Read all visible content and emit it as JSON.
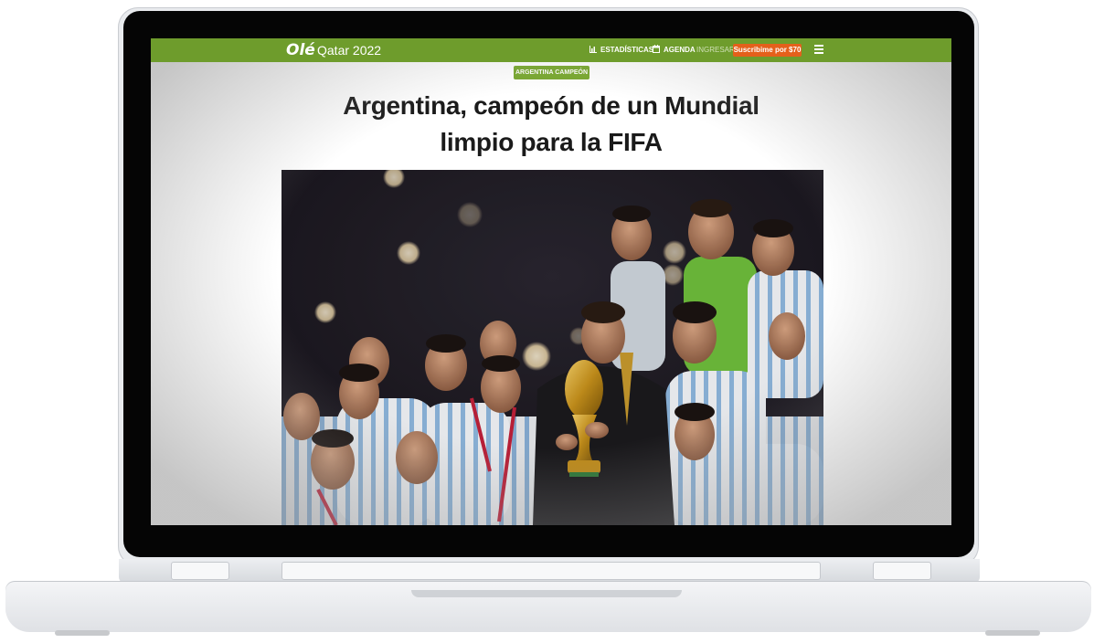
{
  "site": {
    "logo": "Olé",
    "section": "Qatar 2022"
  },
  "nav": {
    "stats_label": "ESTADÍSTICAS",
    "stats_icon": "bar-chart-icon",
    "agenda_label": "AGENDA",
    "agenda_icon": "calendar-icon",
    "login_label": "INGRESAR",
    "subscribe_label": "Suscribime por $70",
    "menu_icon": "hamburger-menu-icon"
  },
  "article": {
    "tag": "ARGENTINA CAMPEÓN",
    "title_line1": "Argentina, campeón de un Mundial",
    "title_line2": "limpio para la FIFA"
  },
  "colors": {
    "brand_green": "#6e9c2c",
    "tag_green": "#78a82e",
    "subscribe_orange": "#e4601b",
    "photo_background": "#1e1a20"
  }
}
